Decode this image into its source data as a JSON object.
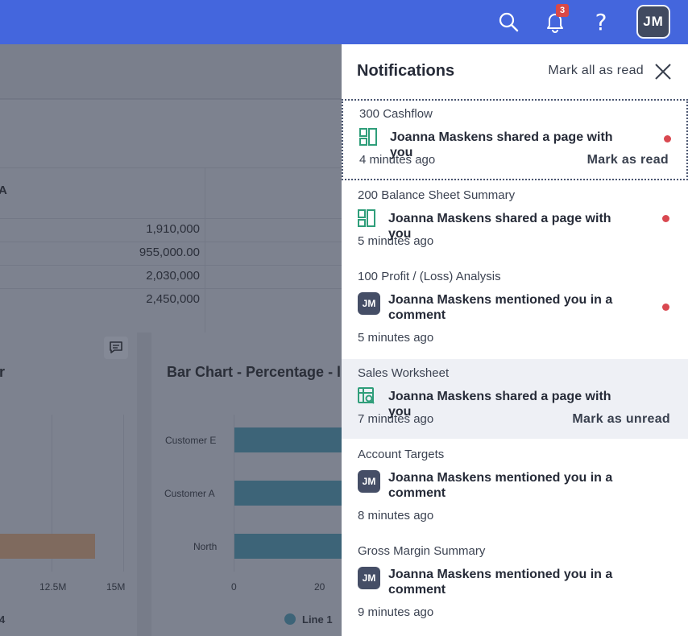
{
  "topbar": {
    "notification_count": "3",
    "help_label": "?",
    "user_initials": "JM",
    "accent_color": "#4466dd"
  },
  "background": {
    "column_header": "A",
    "table_values": [
      "1,910,000",
      "955,000.00",
      "2,030,000",
      "2,450,000"
    ],
    "chart_left_title_fragment": "r",
    "chart_right_title": "Bar Chart - Percentage - l",
    "chart_right_categories": [
      "Customer E",
      "Customer A",
      "North"
    ],
    "chart_right_ticks": [
      "0",
      "20"
    ],
    "chart_left_ticks": [
      "12.5M",
      "15M"
    ],
    "chart_left_footer": "4",
    "legend_label": "Line 1"
  },
  "notifications": {
    "title": "Notifications",
    "mark_all_label": "Mark all as read",
    "items": [
      {
        "source": "300 Cashflow",
        "icon": "page-layout-icon",
        "message": "Joanna Maskens shared a page with you",
        "time": "4 minutes ago",
        "unread": true,
        "action": "Mark as read"
      },
      {
        "source": "200 Balance Sheet Summary",
        "icon": "page-layout-icon",
        "message": "Joanna Maskens shared a page with you",
        "time": "5 minutes ago",
        "unread": true,
        "action": ""
      },
      {
        "source": "100 Profit / (Loss) Analysis",
        "icon": "avatar",
        "avatar_initials": "JM",
        "message": "Joanna Maskens mentioned you in a comment",
        "time": "5 minutes ago",
        "unread": true,
        "action": ""
      },
      {
        "source": "Sales Worksheet",
        "icon": "worksheet-icon",
        "message": "Joanna Maskens shared a page with you",
        "time": "7 minutes ago",
        "unread": false,
        "action": "Mark as unread"
      },
      {
        "source": "Account Targets",
        "icon": "avatar",
        "avatar_initials": "JM",
        "message": "Joanna Maskens mentioned you in a comment",
        "time": "8 minutes ago",
        "unread": false,
        "action": ""
      },
      {
        "source": "Gross Margin Summary",
        "icon": "avatar",
        "avatar_initials": "JM",
        "message": "Joanna Maskens mentioned you in a comment",
        "time": "9 minutes ago",
        "unread": false,
        "action": ""
      }
    ]
  }
}
